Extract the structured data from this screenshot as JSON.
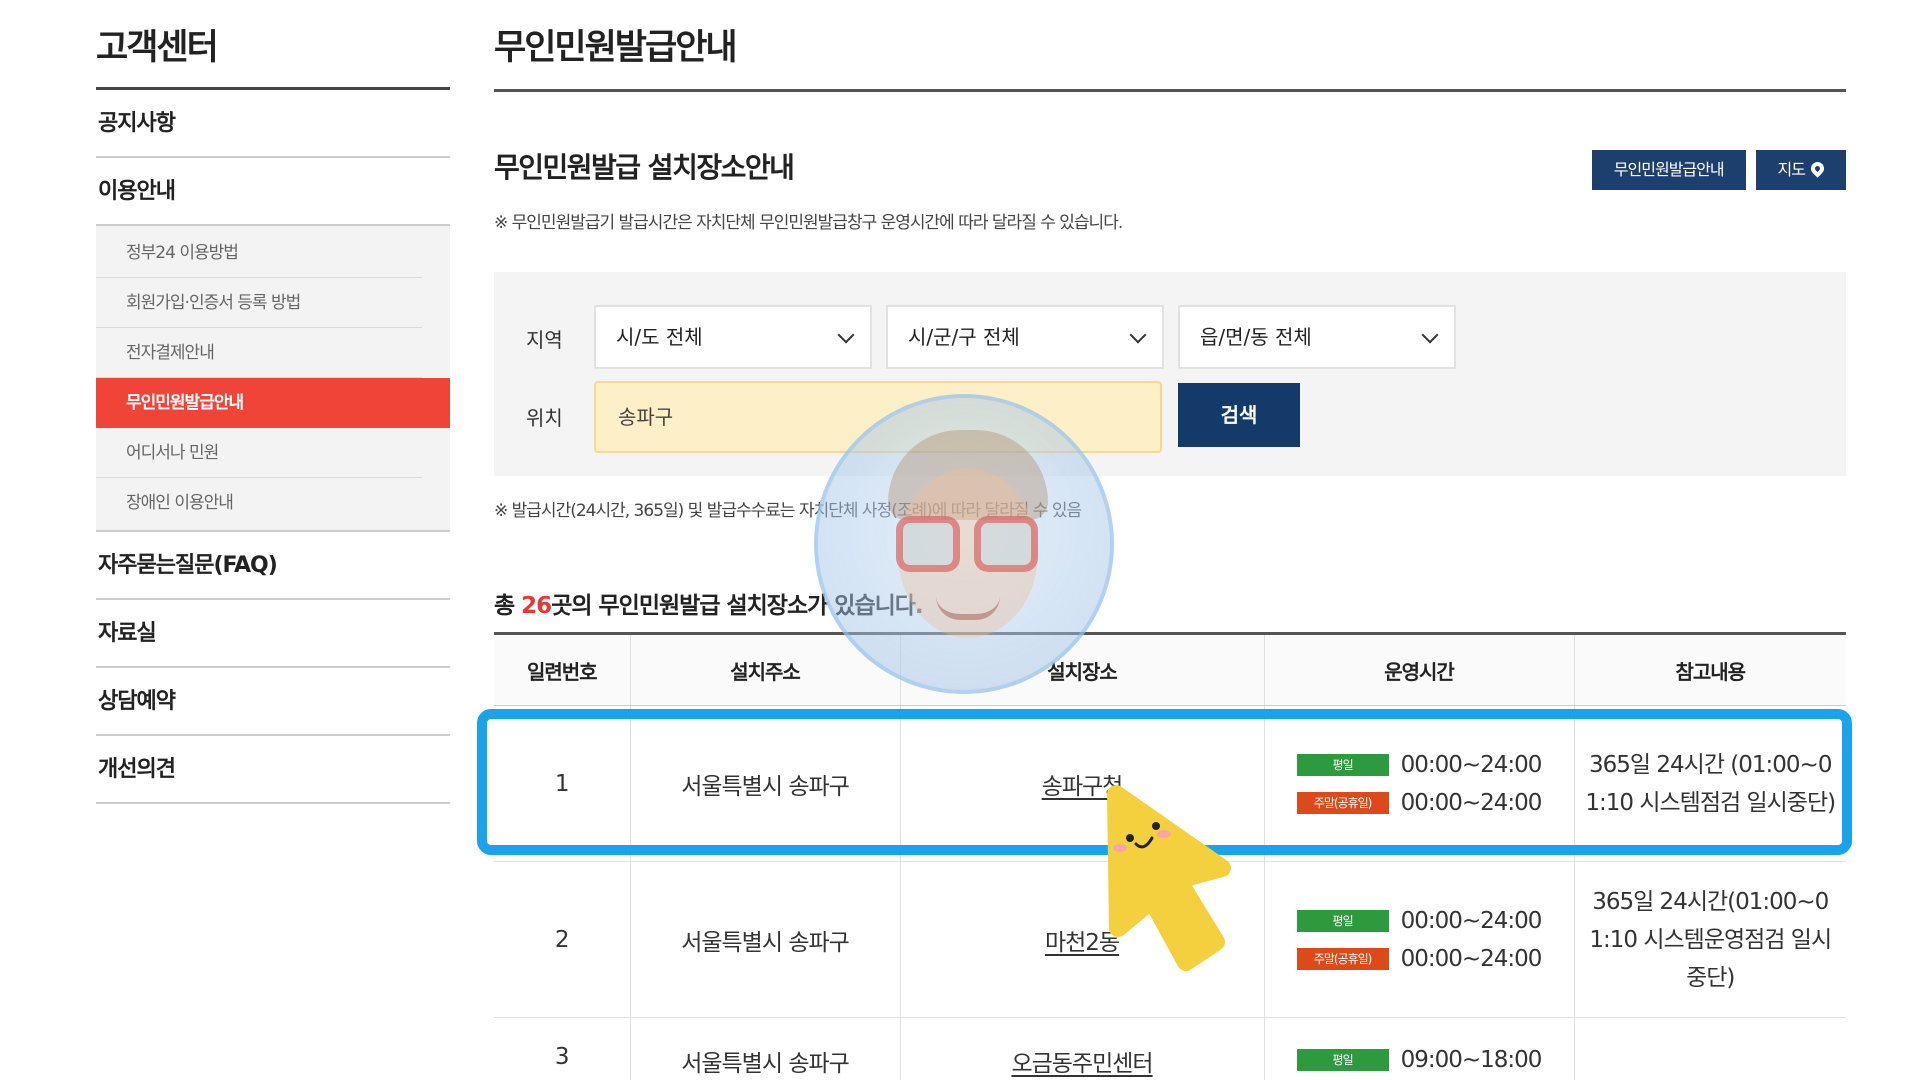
{
  "sidebar": {
    "title": "고객센터",
    "items": [
      {
        "label": "공지사항"
      },
      {
        "label": "이용안내"
      },
      {
        "label": "자주묻는질문(FAQ)"
      },
      {
        "label": "자료실"
      },
      {
        "label": "상담예약"
      },
      {
        "label": "개선의견"
      }
    ],
    "sub_items": [
      {
        "label": "정부24 이용방법"
      },
      {
        "label": "회원가입·인증서 등록 방법"
      },
      {
        "label": "전자결제안내"
      },
      {
        "label": "무인민원발급안내",
        "active": true
      },
      {
        "label": "어디서나 민원"
      },
      {
        "label": "장애인 이용안내"
      }
    ],
    "active_color": "#f04438"
  },
  "main": {
    "page_title": "무인민원발급안내",
    "section_title": "무인민원발급 설치장소안내",
    "notice1": "※ 무인민원발급기 발급시간은 자치단체 무인민원발급창구 운영시간에 따라 달라질 수 있습니다.",
    "buttons": {
      "guide": "무인민원발급안내",
      "map": "지도",
      "map_icon": "map-pin-icon"
    },
    "brand_color": "#1d3f6e"
  },
  "search": {
    "region_label": "지역",
    "location_label": "위치",
    "sido": "시/도 전체",
    "sigungu": "시/군/구 전체",
    "eupmyeondong": "읍/면/동 전체",
    "location_value": "송파구",
    "search_button": "검색"
  },
  "notice2": "※ 발급시간(24시간, 365일) 및 발급수수료는 자치단체 사정(조례)에 따라 달라질 수 있음",
  "count": {
    "prefix": "총 ",
    "number": "26",
    "suffix": "곳의 무인민원발급 설치장소가 있습니다."
  },
  "table": {
    "headers": [
      "일련번호",
      "설치주소",
      "설치장소",
      "운영시간",
      "참고내용"
    ],
    "weekday_badge": "평일",
    "weekend_badge": "주말(공휴일)",
    "rows": [
      {
        "no": "1",
        "address": "서울특별시 송파구",
        "place": "송파구청",
        "weekday": "00:00~24:00",
        "weekend": "00:00~24:00",
        "note": "365일 24시간 (01:00~01:10 시스템점검 일시중단)"
      },
      {
        "no": "2",
        "address": "서울특별시 송파구",
        "place": "마천2동",
        "weekday": "00:00~24:00",
        "weekend": "00:00~24:00",
        "note": "365일 24시간(01:00~01:10 시스템운영점검 일시중단)"
      },
      {
        "no": "3",
        "address": "서울특별시 송파구",
        "place": "오금동주민센터",
        "weekday": "09:00~18:00"
      }
    ]
  },
  "colors": {
    "highlight": "#1aa3e8",
    "badge_weekday": "#2e9a3e",
    "badge_weekend": "#dd4a1a",
    "cursor": "#f4d03f"
  }
}
